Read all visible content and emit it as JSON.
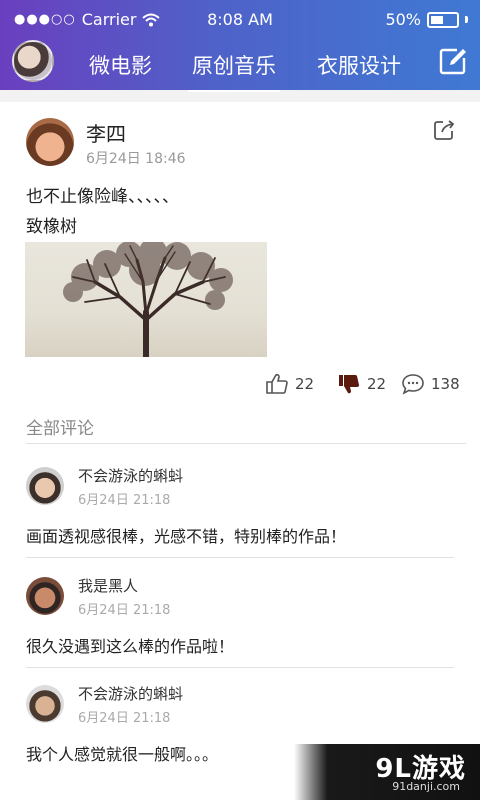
{
  "status_bar": {
    "signal_dots": "●●●○○",
    "carrier": "Carrier",
    "time": "8:08 AM",
    "battery": "50%",
    "battery_level": 0.5
  },
  "nav": {
    "tabs": [
      {
        "label": "微电影"
      },
      {
        "label": "原创音乐",
        "active": true
      },
      {
        "label": "衣服设计"
      }
    ]
  },
  "post": {
    "author": "李四",
    "time": "6月24日 18:46",
    "text_lines": [
      "也不止像险峰、、、、、",
      "致橡树"
    ],
    "likes": "22",
    "dislikes": "22",
    "comments": "138"
  },
  "comments_section": {
    "title": "全部评论",
    "items": [
      {
        "name": "不会游泳的蝌蚪",
        "time": "6月24日 21:18",
        "text": "画面透视感很棒，光感不错，特别棒的作品！"
      },
      {
        "name": "我是黑人",
        "time": "6月24日 21:18",
        "text": "很久没遇到这么棒的作品啦！"
      },
      {
        "name": "不会游泳的蝌蚪",
        "time": "6月24日 21:18",
        "text": "我个人感觉就很一般啊。。。"
      }
    ]
  },
  "watermark": {
    "logo": "9L游戏",
    "url": "91danji.com"
  },
  "colors": {
    "accent_gradient_start": "#6a3fbf",
    "accent_gradient_end": "#3f79d3",
    "dislike_active": "#5a1a0e"
  }
}
